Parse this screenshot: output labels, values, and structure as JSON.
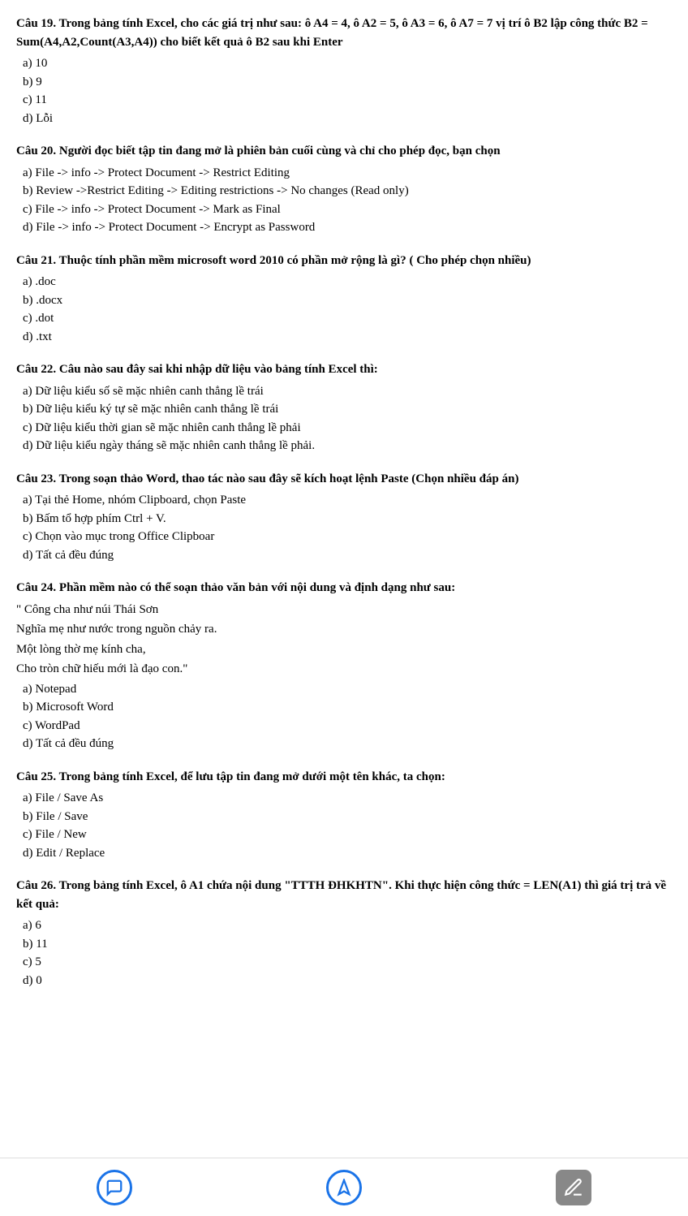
{
  "questions": [
    {
      "id": "q19",
      "title": "Câu 19. Trong bảng tính Excel, cho các giá trị như sau: ô A4 = 4, ô A2 = 5, ô A3 = 6, ô A7 = 7 vị trí ô B2 lập công thức B2 = Sum(A4,A2,Count(A3,A4)) cho biết kết quả ô B2 sau khi Enter",
      "answers": [
        "a) 10",
        "b) 9",
        "c) 11",
        "d) Lỗi"
      ]
    },
    {
      "id": "q20",
      "title": "Câu 20. Người đọc biết tập tin đang mở là phiên bản cuối cùng và chỉ cho phép đọc, bạn chọn",
      "answers": [
        "a) File -> info -> Protect Document -> Restrict Editing",
        "b) Review ->Restrict Editing -> Editing restrictions -> No changes (Read only)",
        "c) File -> info -> Protect Document -> Mark as Final",
        "d) File -> info -> Protect Document -> Encrypt as Password"
      ]
    },
    {
      "id": "q21",
      "title": "Câu 21. Thuộc tính phần mềm microsoft word 2010 có phần mở rộng là gì? ( Cho phép chọn nhiều)",
      "answers": [
        "a) .doc",
        "b) .docx",
        "c) .dot",
        "d) .txt"
      ]
    },
    {
      "id": "q22",
      "title": "Câu 22. Câu nào sau đây sai khi nhập dữ liệu vào bảng tính Excel thì:",
      "answers": [
        "a) Dữ liệu kiểu số sẽ mặc nhiên canh thẳng lề trái",
        "b) Dữ liệu kiểu ký tự sẽ mặc nhiên canh thẳng lề trái",
        "c) Dữ liệu kiểu thời gian sẽ mặc nhiên canh thẳng lề phải",
        "d) Dữ liệu kiểu ngày tháng sẽ mặc nhiên canh thẳng lề phải."
      ]
    },
    {
      "id": "q23",
      "title": "Câu 23. Trong soạn thảo Word, thao tác nào sau đây sẽ kích hoạt lệnh Paste (Chọn nhiều đáp án)",
      "answers": [
        "a) Tại thẻ Home, nhóm Clipboard, chọn Paste",
        "b) Bấm tổ hợp phím Ctrl + V.",
        "c) Chọn vào mục trong Office Clipboar",
        "d) Tất cả đều đúng"
      ]
    },
    {
      "id": "q24",
      "title": "Câu 24. Phần mềm nào có thể soạn thảo văn bản với nội dung và định dạng như sau:",
      "poem": [
        "\" Công cha như núi Thái Sơn",
        "Nghĩa mẹ như nước trong nguồn chảy ra.",
        "Một lòng thờ mẹ kính cha,",
        "Cho tròn chữ hiếu mới là đạo con.\""
      ],
      "answers": [
        "a) Notepad",
        "b) Microsoft Word",
        "c) WordPad",
        "d) Tất cả đều đúng"
      ]
    },
    {
      "id": "q25",
      "title": "Câu 25. Trong bảng tính Excel, để lưu tập tin đang mở dưới một tên khác, ta chọn:",
      "answers": [
        "a) File / Save As",
        "b) File / Save",
        "c) File / New",
        "d) Edit / Replace"
      ]
    },
    {
      "id": "q26",
      "title": "Câu 26. Trong bảng tính Excel, ô A1 chứa nội dung \"TTTH ĐHKHTN\". Khi thực hiện công thức = LEN(A1) thì giá trị trả về kết quả:",
      "answers": [
        "a) 6",
        "b) 11",
        "c) 5",
        "d) 0"
      ]
    }
  ],
  "bottom_bar": {
    "btn1_icon": "chat-bubble-icon",
    "btn2_icon": "navigation-icon",
    "btn3_icon": "pencil-icon"
  }
}
